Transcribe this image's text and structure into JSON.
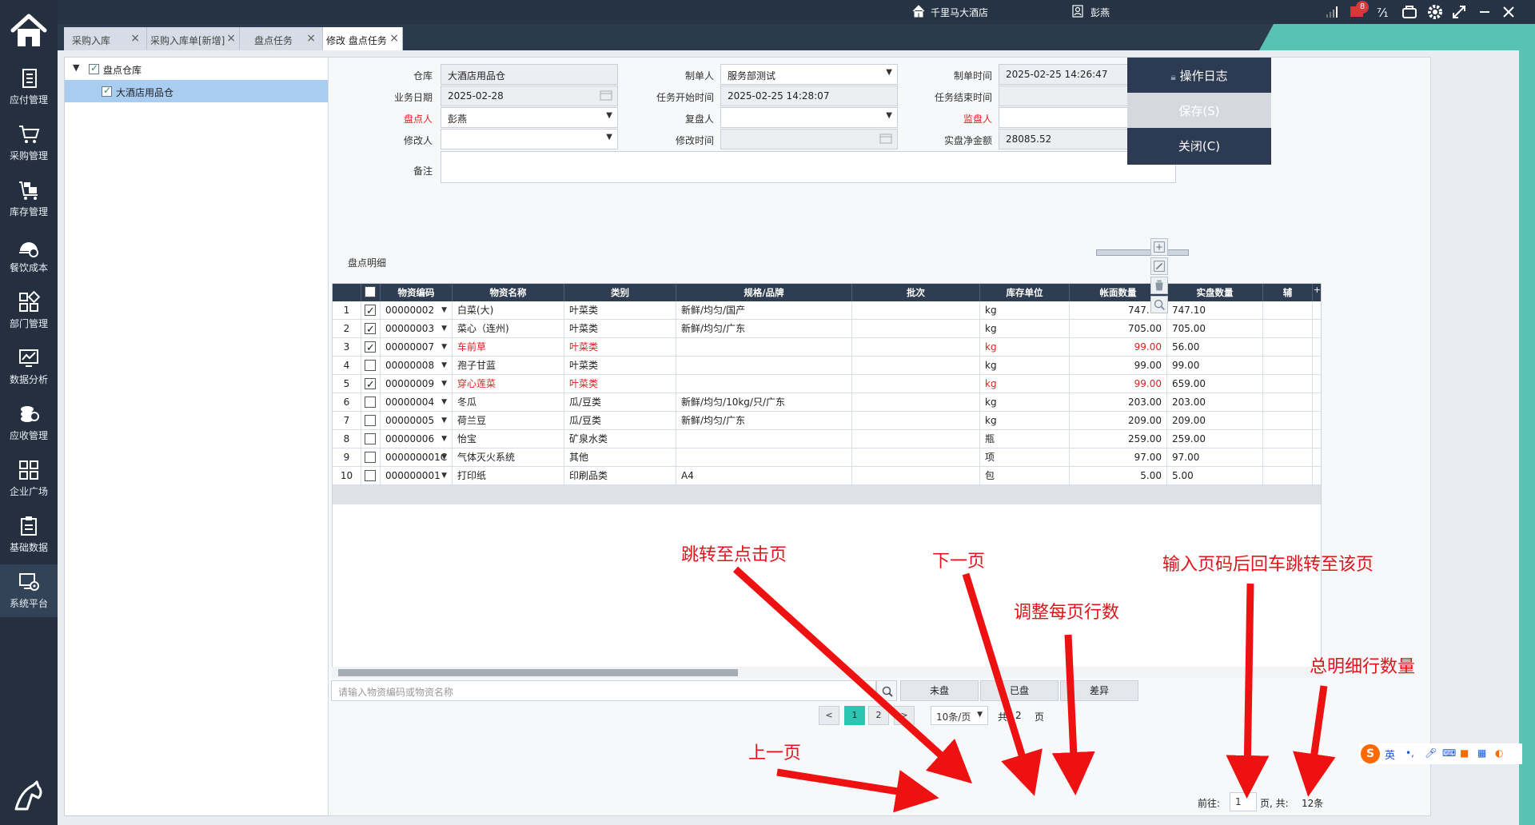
{
  "sidebar": {
    "items": [
      {
        "label": "应付管理",
        "icon": "payables-icon"
      },
      {
        "label": "采购管理",
        "icon": "cart-icon"
      },
      {
        "label": "库存管理",
        "icon": "warehouse-cart-icon"
      },
      {
        "label": "餐饮成本",
        "icon": "cost-icon"
      },
      {
        "label": "部门管理",
        "icon": "grid-icon"
      },
      {
        "label": "数据分析",
        "icon": "chart-icon"
      },
      {
        "label": "应收管理",
        "icon": "coins-icon"
      },
      {
        "label": "企业广场",
        "icon": "apps-icon"
      },
      {
        "label": "基础数据",
        "icon": "clipboard-icon"
      },
      {
        "label": "系统平台",
        "icon": "system-icon"
      }
    ]
  },
  "topbar": {
    "hotel": "千里马大酒店",
    "user": "彭燕",
    "notification_count": "8"
  },
  "tabs": [
    {
      "label": "采购入库"
    },
    {
      "label": "采购入库单[新增]"
    },
    {
      "label": "盘点任务"
    },
    {
      "label": "修改 盘点任务"
    }
  ],
  "tree": {
    "root": "盘点仓库",
    "child": "大酒店用品仓"
  },
  "form": {
    "warehouse_label": "仓库",
    "warehouse_value": "大酒店用品仓",
    "creator_label": "制单人",
    "creator_value": "服务部测试",
    "created_time_label": "制单时间",
    "created_time_value": "2025-02-25 14:26:47",
    "biz_date_label": "业务日期",
    "biz_date_value": "2025-02-28",
    "task_start_label": "任务开始时间",
    "task_start_value": "2025-02-25 14:28:07",
    "task_end_label": "任务结束时间",
    "task_end_value": "",
    "counter_label": "盘点人",
    "counter_value": "彭燕",
    "rechecker_label": "复盘人",
    "rechecker_value": "",
    "supervisor_label": "监盘人",
    "supervisor_value": "",
    "modifier_label": "修改人",
    "modifier_value": "",
    "modify_time_label": "修改时间",
    "modify_time_value": "",
    "net_amount_label": "实盘净金额",
    "net_amount_value": "28085.52",
    "remark_label": "备注",
    "remark_value": ""
  },
  "buttons": {
    "log": "操作日志",
    "save": "保存(S)",
    "close": "关闭(C)"
  },
  "detail": {
    "title": "盘点明细",
    "columns": [
      "",
      "",
      "物资编码",
      "物资名称",
      "类别",
      "规格/品牌",
      "批次",
      "库存单位",
      "帐面数量",
      "实盘数量",
      "辅"
    ],
    "rows": [
      {
        "no": "1",
        "checked": true,
        "code": "00000002",
        "name": "白菜(大)",
        "category": "叶菜类",
        "spec": "新鲜/均匀/国产",
        "batch": "",
        "unit": "kg",
        "book": "747.10",
        "actual": "747.10",
        "red": false
      },
      {
        "no": "2",
        "checked": true,
        "code": "00000003",
        "name": "菜心（连州)",
        "category": "叶菜类",
        "spec": "新鲜/均匀/广东",
        "batch": "",
        "unit": "kg",
        "book": "705.00",
        "actual": "705.00",
        "red": false
      },
      {
        "no": "3",
        "checked": true,
        "code": "00000007",
        "name": "车前草",
        "category": "叶菜类",
        "spec": "",
        "batch": "",
        "unit": "kg",
        "book": "99.00",
        "actual": "56.00",
        "red": true
      },
      {
        "no": "4",
        "checked": false,
        "code": "00000008",
        "name": "孢子甘蓝",
        "category": "叶菜类",
        "spec": "",
        "batch": "",
        "unit": "kg",
        "book": "99.00",
        "actual": "99.00",
        "red": false
      },
      {
        "no": "5",
        "checked": true,
        "code": "00000009",
        "name": "穿心莲菜",
        "category": "叶菜类",
        "spec": "",
        "batch": "",
        "unit": "kg",
        "book": "99.00",
        "actual": "659.00",
        "red": true
      },
      {
        "no": "6",
        "checked": false,
        "code": "00000004",
        "name": "冬瓜",
        "category": "瓜/豆类",
        "spec": "新鲜/均匀/10kg/只/广东",
        "batch": "",
        "unit": "kg",
        "book": "203.00",
        "actual": "203.00",
        "red": false
      },
      {
        "no": "7",
        "checked": false,
        "code": "00000005",
        "name": "荷兰豆",
        "category": "瓜/豆类",
        "spec": "新鲜/均匀/广东",
        "batch": "",
        "unit": "kg",
        "book": "209.00",
        "actual": "209.00",
        "red": false
      },
      {
        "no": "8",
        "checked": false,
        "code": "00000006",
        "name": "怡宝",
        "category": "矿泉水类",
        "spec": "",
        "batch": "",
        "unit": "瓶",
        "book": "259.00",
        "actual": "259.00",
        "red": false
      },
      {
        "no": "9",
        "checked": false,
        "code": "000000001C",
        "name": "气体灭火系统",
        "category": "其他",
        "spec": "",
        "batch": "",
        "unit": "项",
        "book": "97.00",
        "actual": "97.00",
        "red": false
      },
      {
        "no": "10",
        "checked": false,
        "code": "000000001",
        "name": "打印纸",
        "category": "印刷品类",
        "spec": "A4",
        "batch": "",
        "unit": "包",
        "book": "5.00",
        "actual": "5.00",
        "red": false
      }
    ]
  },
  "filter": {
    "search_placeholder": "请输入物资编码或物资名称",
    "unchecked": "未盘",
    "checked": "已盘",
    "diff": "差异"
  },
  "pagination": {
    "prev": "<",
    "page1": "1",
    "page2": "2",
    "next": ">",
    "page_size": "10条/页",
    "total_pages_prefix": "共:",
    "total_pages": "2",
    "page_unit": "页",
    "goto_label": "前往:",
    "goto_value": "1",
    "total_suffix": "页, 共:",
    "total_count": "12条"
  },
  "annotations": {
    "jump": "跳转至点击页",
    "next": "下一页",
    "size": "调整每页行数",
    "goto": "输入页码后回车跳转至该页",
    "total": "总明细行数量",
    "prev": "上一页"
  },
  "ime": {
    "lang": "英"
  }
}
